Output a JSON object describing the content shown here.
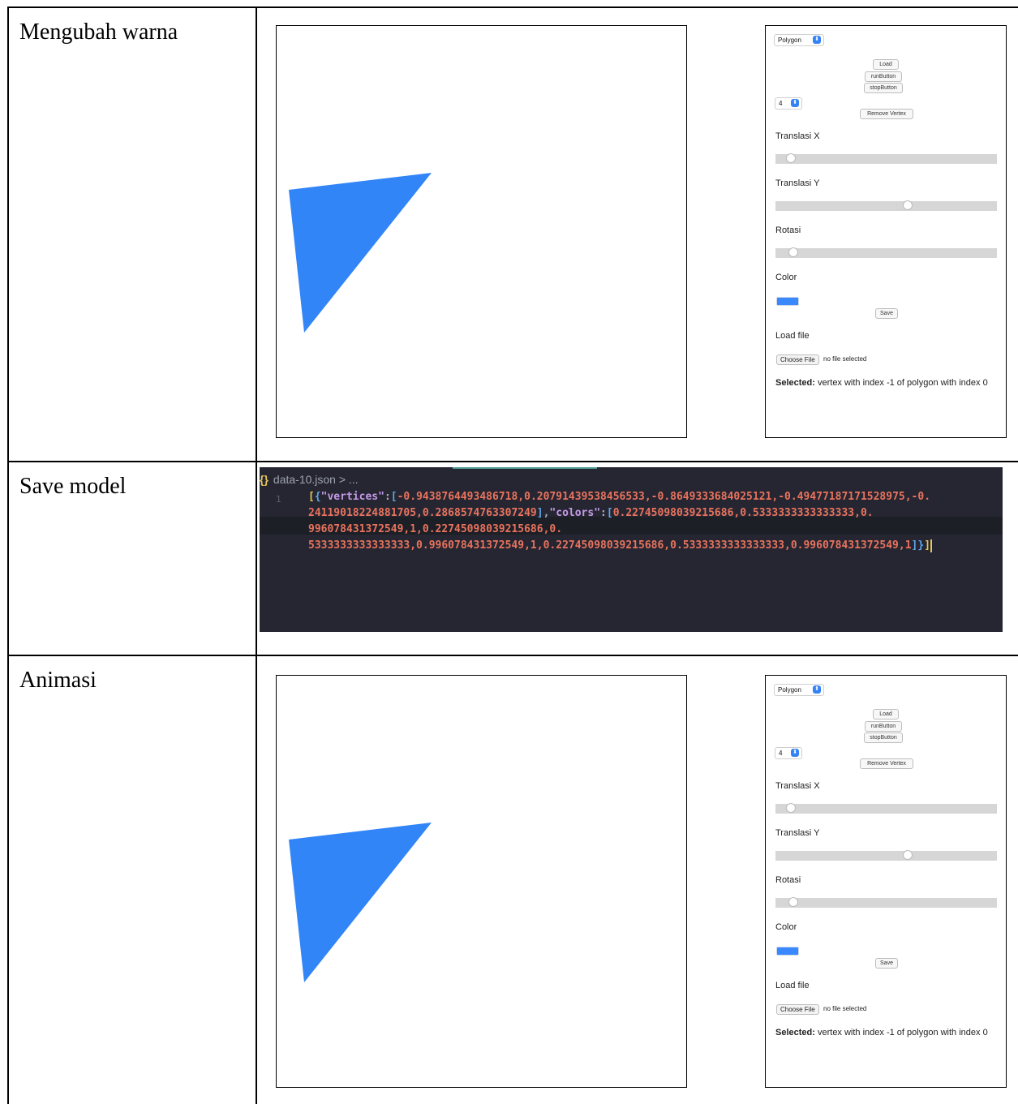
{
  "rows": [
    {
      "label": "Mengubah warna"
    },
    {
      "label": "Save model"
    },
    {
      "label": "Animasi"
    }
  ],
  "app_panel": {
    "shape_select": "Polygon",
    "load_button": "Load",
    "run_button": "runButton",
    "stop_button": "stopButton",
    "vertex_count_select": "4",
    "remove_vertex_button": "Remove Vertex",
    "translasi_x_label": "Translasi X",
    "translasi_x_value": 0.05,
    "translasi_y_label": "Translasi Y",
    "translasi_y_value": 0.6,
    "rotasi_label": "Rotasi",
    "rotasi_value": 0.06,
    "color_label": "Color",
    "color_value": "#3a88fe",
    "save_button": "Save",
    "load_file_label": "Load file",
    "choose_file_button": "Choose File",
    "no_file_text": "no file selected",
    "selected_label": "Selected:",
    "selected_text": " vertex with index -1 of polygon with index 0"
  },
  "shape_color": "#3285f7",
  "editor": {
    "filename": "data-10.json",
    "crumb_tail": " > ...",
    "line_number": "1",
    "vertices_key": "\"vertices\"",
    "colors_key": "\"colors\"",
    "vertices": "-0.9438764493486718,0.20791439538456533,-0.8649333684025121,-0.49477187171528975,-0.24119018224881705,0.2868574763307249",
    "colors": "0.22745098039215686,0.5333333333333333,0.996078431372549,1,0.22745098039215686,0.5333333333333333,0.996078431372549,1,0.22745098039215686,0.5333333333333333,0.996078431372549,1"
  }
}
